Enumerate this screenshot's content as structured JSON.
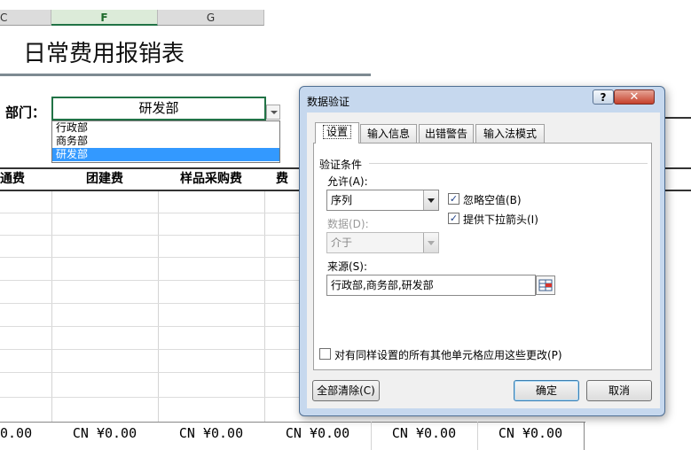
{
  "sheet": {
    "col_headers": [
      {
        "label": "C"
      },
      {
        "label": "F"
      },
      {
        "label": "G"
      }
    ],
    "title": "日常费用报销表",
    "dept_label": "部门：",
    "dept_value": "研发部",
    "dropdown_options": [
      "行政部",
      "商务部",
      "研发部"
    ],
    "table_headers": [
      "通费",
      "团建费",
      "样品采购费",
      "费"
    ],
    "totals": [
      "0.00",
      "CN ¥0.00",
      "CN ¥0.00",
      "CN ¥0.00",
      "CN ¥0.00",
      "CN ¥0.00"
    ]
  },
  "dialog": {
    "title": "数据验证",
    "help_label": "?",
    "close_label": "✕",
    "tabs": [
      "设置",
      "输入信息",
      "出错警告",
      "输入法模式"
    ],
    "active_tab": "设置",
    "group_label": "验证条件",
    "allow_label": "允许(A):",
    "allow_value": "序列",
    "ignore_blank_label": "忽略空值(B)",
    "ignore_blank_checked": true,
    "dropdown_arrow_label": "提供下拉箭头(I)",
    "dropdown_arrow_checked": true,
    "data_label": "数据(D):",
    "data_value": "介于",
    "source_label": "来源(S):",
    "source_value": "行政部,商务部,研发部",
    "apply_all_label": "对有同样设置的所有其他单元格应用这些更改(P)",
    "apply_all_checked": false,
    "clear_all_label": "全部清除(C)",
    "ok_label": "确定",
    "cancel_label": "取消"
  },
  "colors": {
    "excel_green": "#217346",
    "selection_blue": "#3399ff",
    "dialog_frame": "#c6d8ee"
  }
}
